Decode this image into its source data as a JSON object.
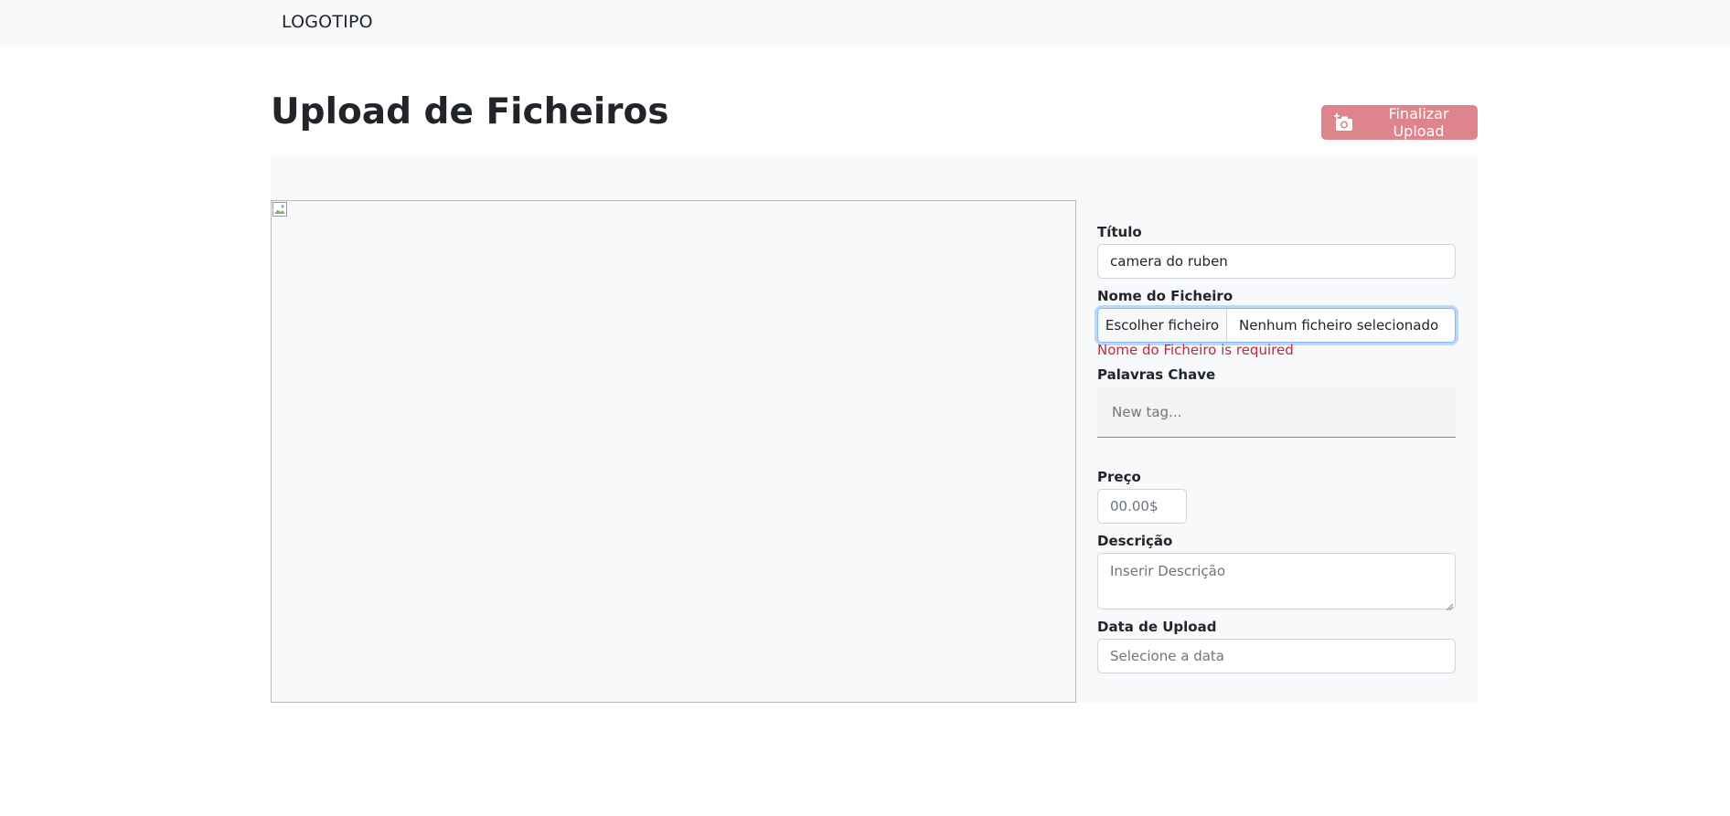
{
  "navbar": {
    "brand": "LOGOTIPO"
  },
  "header": {
    "title": "Upload de Ficheiros",
    "finalize_button": {
      "label": "Finalizar Upload",
      "icon": "camera-plus-icon",
      "color": "#de848d"
    }
  },
  "preview": {
    "image_state": "broken-image-icon"
  },
  "form": {
    "titulo": {
      "label": "Título",
      "value": "camera do ruben"
    },
    "ficheiro": {
      "label": "Nome do Ficheiro",
      "button_label": "Escolher ficheiro",
      "file_status": "Nenhum ficheiro selecionado",
      "error": "Nome do Ficheiro is required",
      "error_color": "#b52e3a"
    },
    "palavras_chave": {
      "label": "Palavras Chave",
      "placeholder": "New tag..."
    },
    "preco": {
      "label": "Preço",
      "placeholder": "00.00$"
    },
    "descricao": {
      "label": "Descrição",
      "placeholder": "Inserir Descrição"
    },
    "data_upload": {
      "label": "Data de Upload",
      "placeholder": "Selecione a data"
    }
  }
}
